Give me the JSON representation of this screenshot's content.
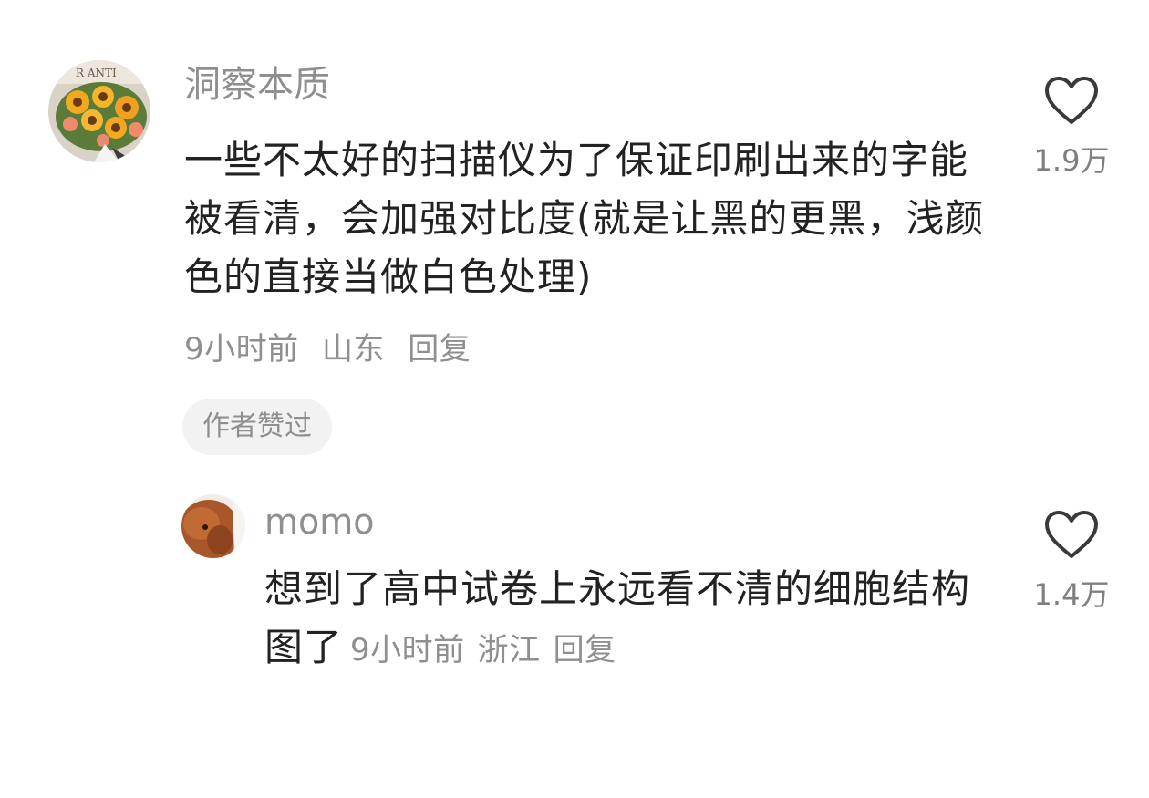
{
  "comment": {
    "username": "洞察本质",
    "text": "一些不太好的扫描仪为了保证印刷出来的字能被看清，会加强对比度(就是让黑的更黑，浅颜色的直接当做白色处理)",
    "time": "9小时前",
    "location": "山东",
    "reply_label": "回复",
    "author_liked_label": "作者赞过",
    "like_count": "1.9万",
    "avatar_icon": "sunflower-bouquet-avatar",
    "like_icon": "heart-outline-icon"
  },
  "reply": {
    "username": "momo",
    "text": "想到了高中试卷上永远看不清的细胞结构图了",
    "time": "9小时前",
    "location": "浙江",
    "reply_label": "回复",
    "like_count": "1.4万",
    "avatar_icon": "dog-avatar",
    "like_icon": "heart-outline-icon"
  }
}
